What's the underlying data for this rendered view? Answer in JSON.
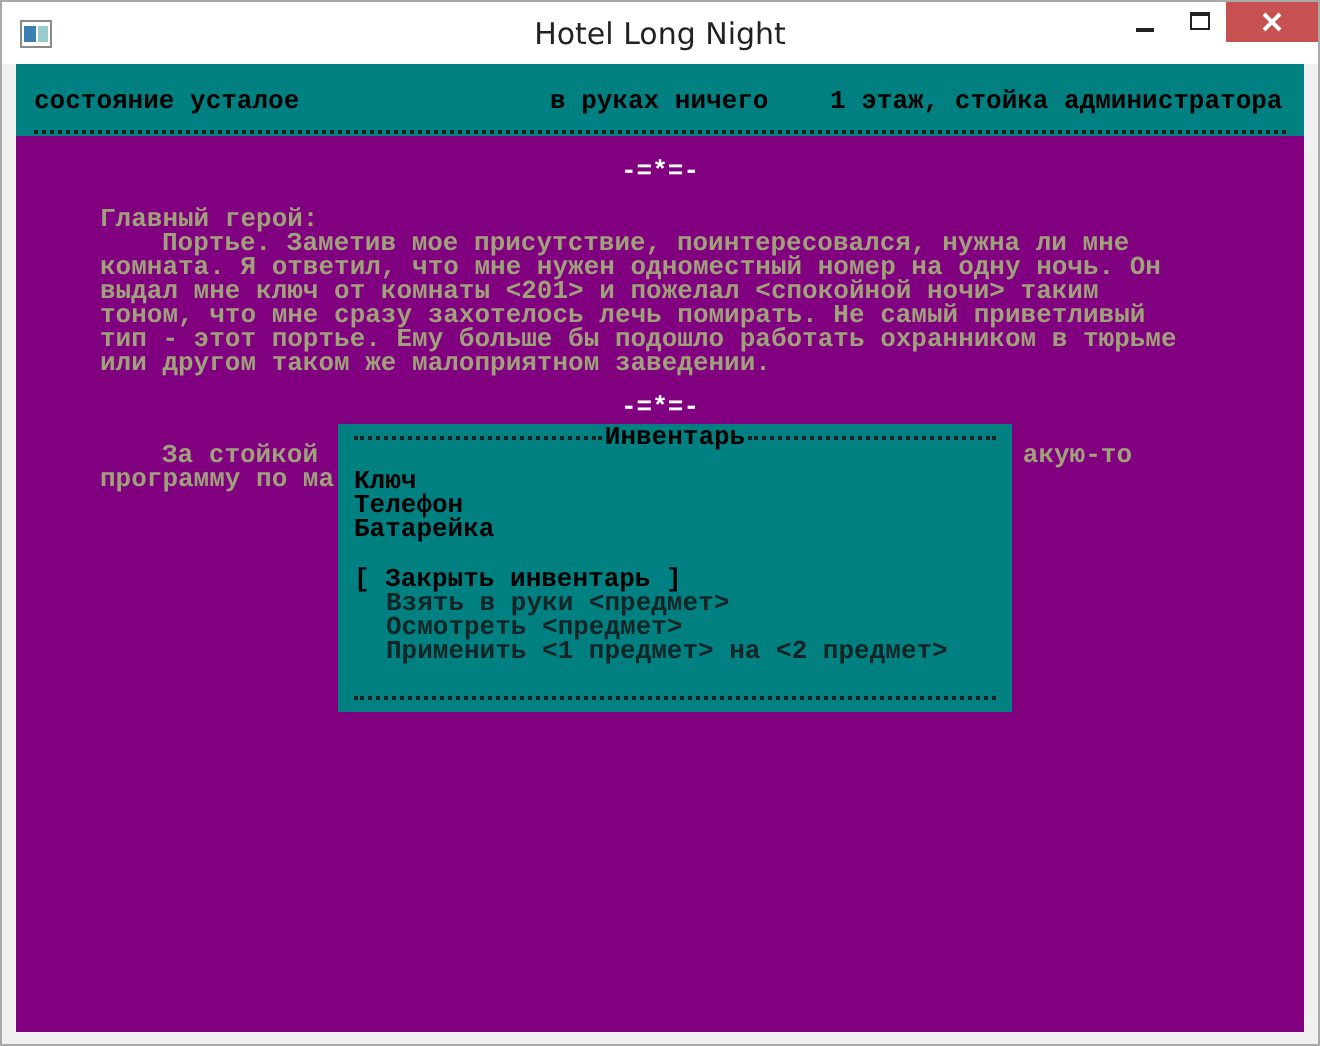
{
  "window": {
    "title": "Hotel Long Night"
  },
  "status_bar": {
    "state": "состояние усталое",
    "hands": "в руках ничего",
    "location": "1 этаж, стойка администратора"
  },
  "log": [
    {
      "kind": "separator",
      "text": "-=*=-"
    },
    {
      "kind": "heading",
      "text": "Главный герой:"
    },
    {
      "kind": "paragraph",
      "lines": [
        "Портье. Заметив мое присутствие, поинтересовался, нужна ли мне",
        "комната. Я ответил, что мне нужен одноместный номер на одну ночь. Он",
        "выдал мне ключ от комнаты <201> и пожелал <спокойной ночи> таким",
        "тоном, что мне сразу захотелось лечь помирать. Не самый приветливый",
        "тип - этот портье. Ему больше бы подошло работать охранником в тюрьме",
        "или другом таком же малоприятном заведении."
      ]
    },
    {
      "kind": "separator",
      "text": "-=*=-"
    },
    {
      "kind": "covered",
      "lines": [
        [
          "За стойкой",
          "акую-то"
        ],
        [
          "программу по ма"
        ]
      ]
    }
  ],
  "inventory": {
    "title": "Инвентарь",
    "items": [
      "Ключ",
      "Телефон",
      "Батарейка"
    ],
    "actions": [
      {
        "label": "[ Закрыть инвентарь ]",
        "selected": true
      },
      {
        "label": "Взять в руки <предмет>",
        "selected": false
      },
      {
        "label": "Осмотреть <предмет>",
        "selected": false
      },
      {
        "label": "Применить <1 предмет> на <2 предмет>",
        "selected": false
      }
    ]
  }
}
